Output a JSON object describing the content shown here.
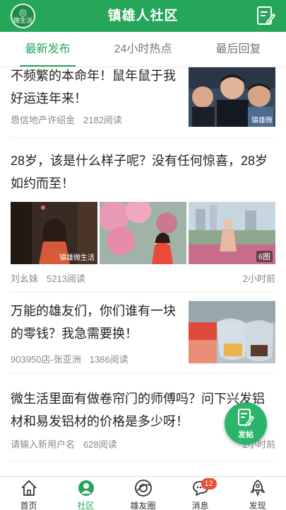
{
  "header": {
    "title": "镇雄人社区",
    "logo_text": "微生活",
    "compose_icon": "compose-icon"
  },
  "tabs": [
    {
      "label": "最新发布",
      "active": true
    },
    {
      "label": "24小时热点",
      "active": false
    },
    {
      "label": "最后回复",
      "active": false
    }
  ],
  "posts": [
    {
      "title": "不频繁的本命年！鼠年鼠于我好运连年来！",
      "author": "恩信地产许绍金",
      "reads": "2182阅读",
      "time": "",
      "thumb_watermark": "镇雄微"
    },
    {
      "title": "28岁，该是什么样子呢？没有任何惊喜，28岁如约而至！",
      "author": "刘幺妹",
      "reads": "5213阅读",
      "time": "2小时前",
      "image_count": "6图",
      "watermark": "镇雄微生活"
    },
    {
      "title": "万能的雄友们，你们谁有一块的零钱？我急需要换！",
      "author": "903950店-张亚洲",
      "reads": "1386阅读",
      "time": ""
    },
    {
      "title": "微生活里面有做卷帘门的师傅吗？问下兴发铝材和易发铝材的价格是多少呀！",
      "author": "请输入新用户名",
      "reads": "628阅读",
      "time": "2小时前"
    }
  ],
  "fab": {
    "label": "发帖"
  },
  "bottom_nav": [
    {
      "label": "首页",
      "icon": "home-icon",
      "active": false
    },
    {
      "label": "社区",
      "icon": "community-icon",
      "active": true
    },
    {
      "label": "雄友圈",
      "icon": "friends-circle-icon",
      "active": false
    },
    {
      "label": "消息",
      "icon": "message-icon",
      "active": false,
      "badge": "12"
    },
    {
      "label": "发现",
      "icon": "discover-icon",
      "active": false
    }
  ],
  "colors": {
    "brand": "#25a65a",
    "badge": "#f04a3b"
  }
}
